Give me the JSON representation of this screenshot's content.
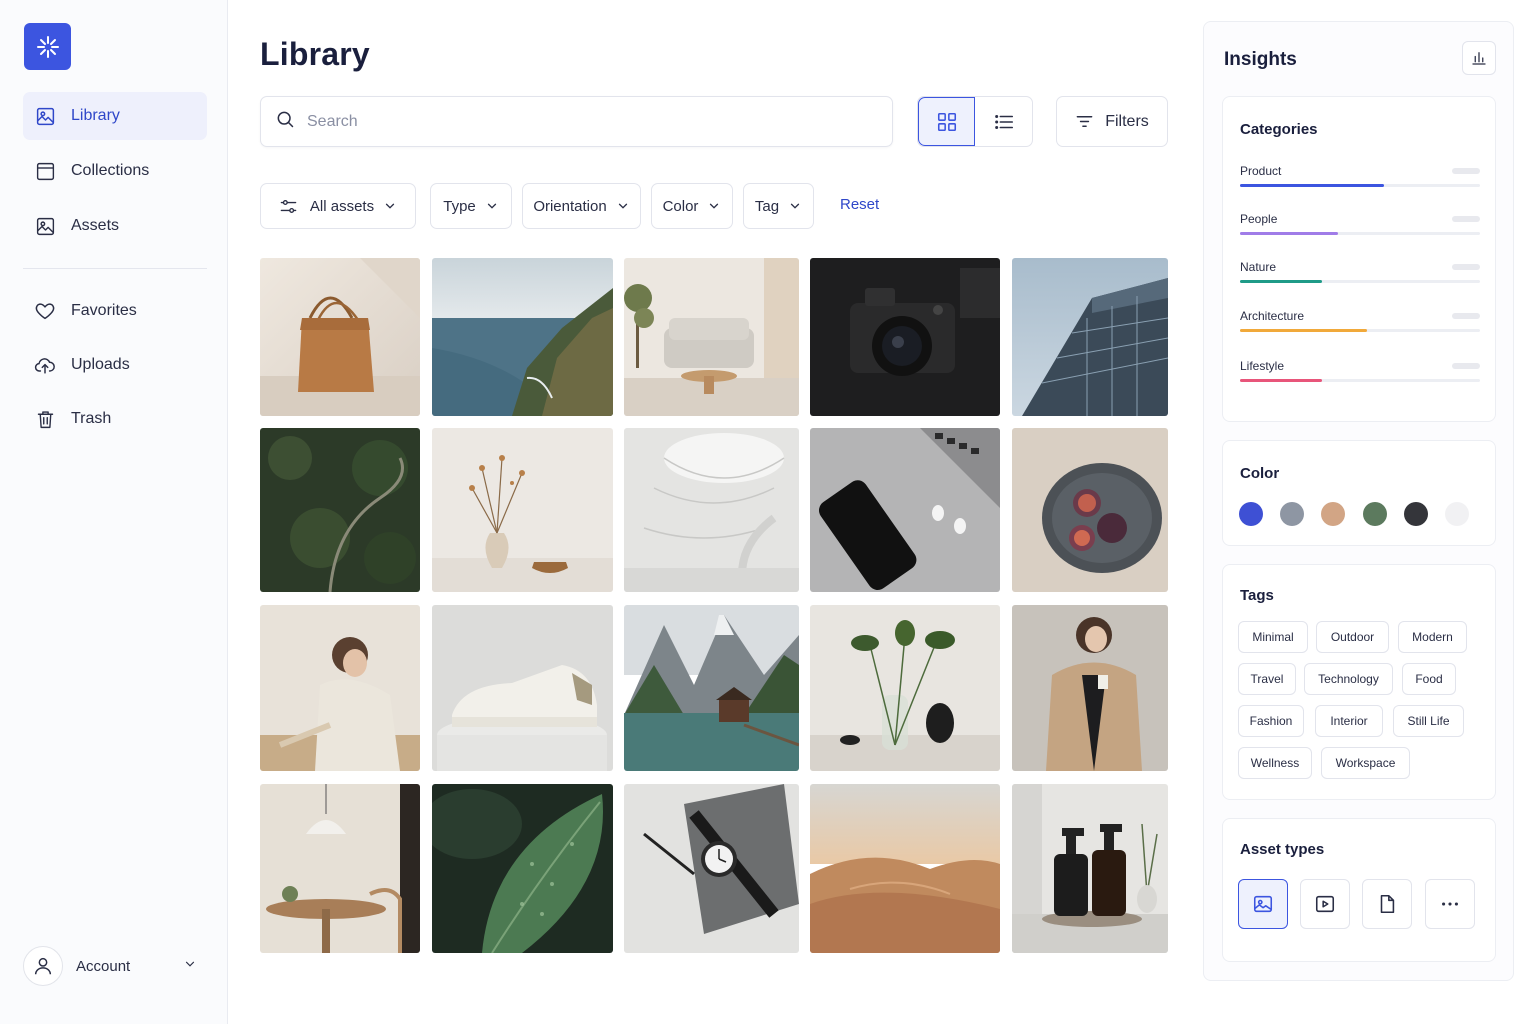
{
  "sidebar": {
    "items": [
      {
        "label": "Library",
        "icon": "image-icon",
        "active": true
      },
      {
        "label": "Collections",
        "icon": "folder-icon"
      },
      {
        "label": "Assets",
        "icon": "image-icon"
      },
      {
        "label": "Favorites",
        "icon": "heart-icon"
      },
      {
        "label": "Uploads",
        "icon": "cloud-upload-icon"
      },
      {
        "label": "Trash",
        "icon": "trash-icon"
      }
    ],
    "account_label": "Account"
  },
  "main": {
    "title": "Library",
    "search": {
      "placeholder": "Search",
      "value": ""
    },
    "filters_label": "Filters",
    "chips": {
      "all_assets": "All assets",
      "type": "Type",
      "orientation": "Orientation",
      "color": "Color",
      "tag": "Tag"
    },
    "reset_label": "Reset",
    "grid": [
      [
        "tote-bag",
        "coastline",
        "living-room",
        "camera",
        "glass-building"
      ],
      [
        "forest-road",
        "dried-flowers-vase",
        "white-architecture",
        "phone-earbuds",
        "figs-plate"
      ],
      [
        "woman-writing",
        "white-sneaker",
        "mountain-lake",
        "plant-vase",
        "woman-coat"
      ],
      [
        "dining-lamp",
        "leaf-droplets",
        "watch-notebook",
        "desert-dunes",
        "soap-bottles"
      ]
    ]
  },
  "insights": {
    "title": "Insights",
    "categories_title": "Categories",
    "categories": [
      {
        "label": "Product",
        "share": 0.6,
        "color": "#3c55e0"
      },
      {
        "label": "People",
        "share": 0.41,
        "color": "#a07ce8"
      },
      {
        "label": "Nature",
        "share": 0.34,
        "color": "#1f9b88"
      },
      {
        "label": "Architecture",
        "share": 0.53,
        "color": "#f1a93a"
      },
      {
        "label": "Lifestyle",
        "share": 0.34,
        "color": "#e8557a"
      }
    ],
    "color_title": "Color",
    "colors": [
      "#3e50d4",
      "#8e96a3",
      "#d2a585",
      "#5c7a5e",
      "#34353a",
      "#f1f1f3"
    ],
    "tags_title": "Tags",
    "tags": [
      "Minimal",
      "Outdoor",
      "Modern",
      "Travel",
      "Technology",
      "Food",
      "Fashion",
      "Interior",
      "Still Life",
      "Wellness",
      "Workspace"
    ],
    "asset_types_title": "Asset types",
    "asset_types": [
      "image-icon",
      "video-icon",
      "document-icon",
      "more-icon"
    ]
  }
}
